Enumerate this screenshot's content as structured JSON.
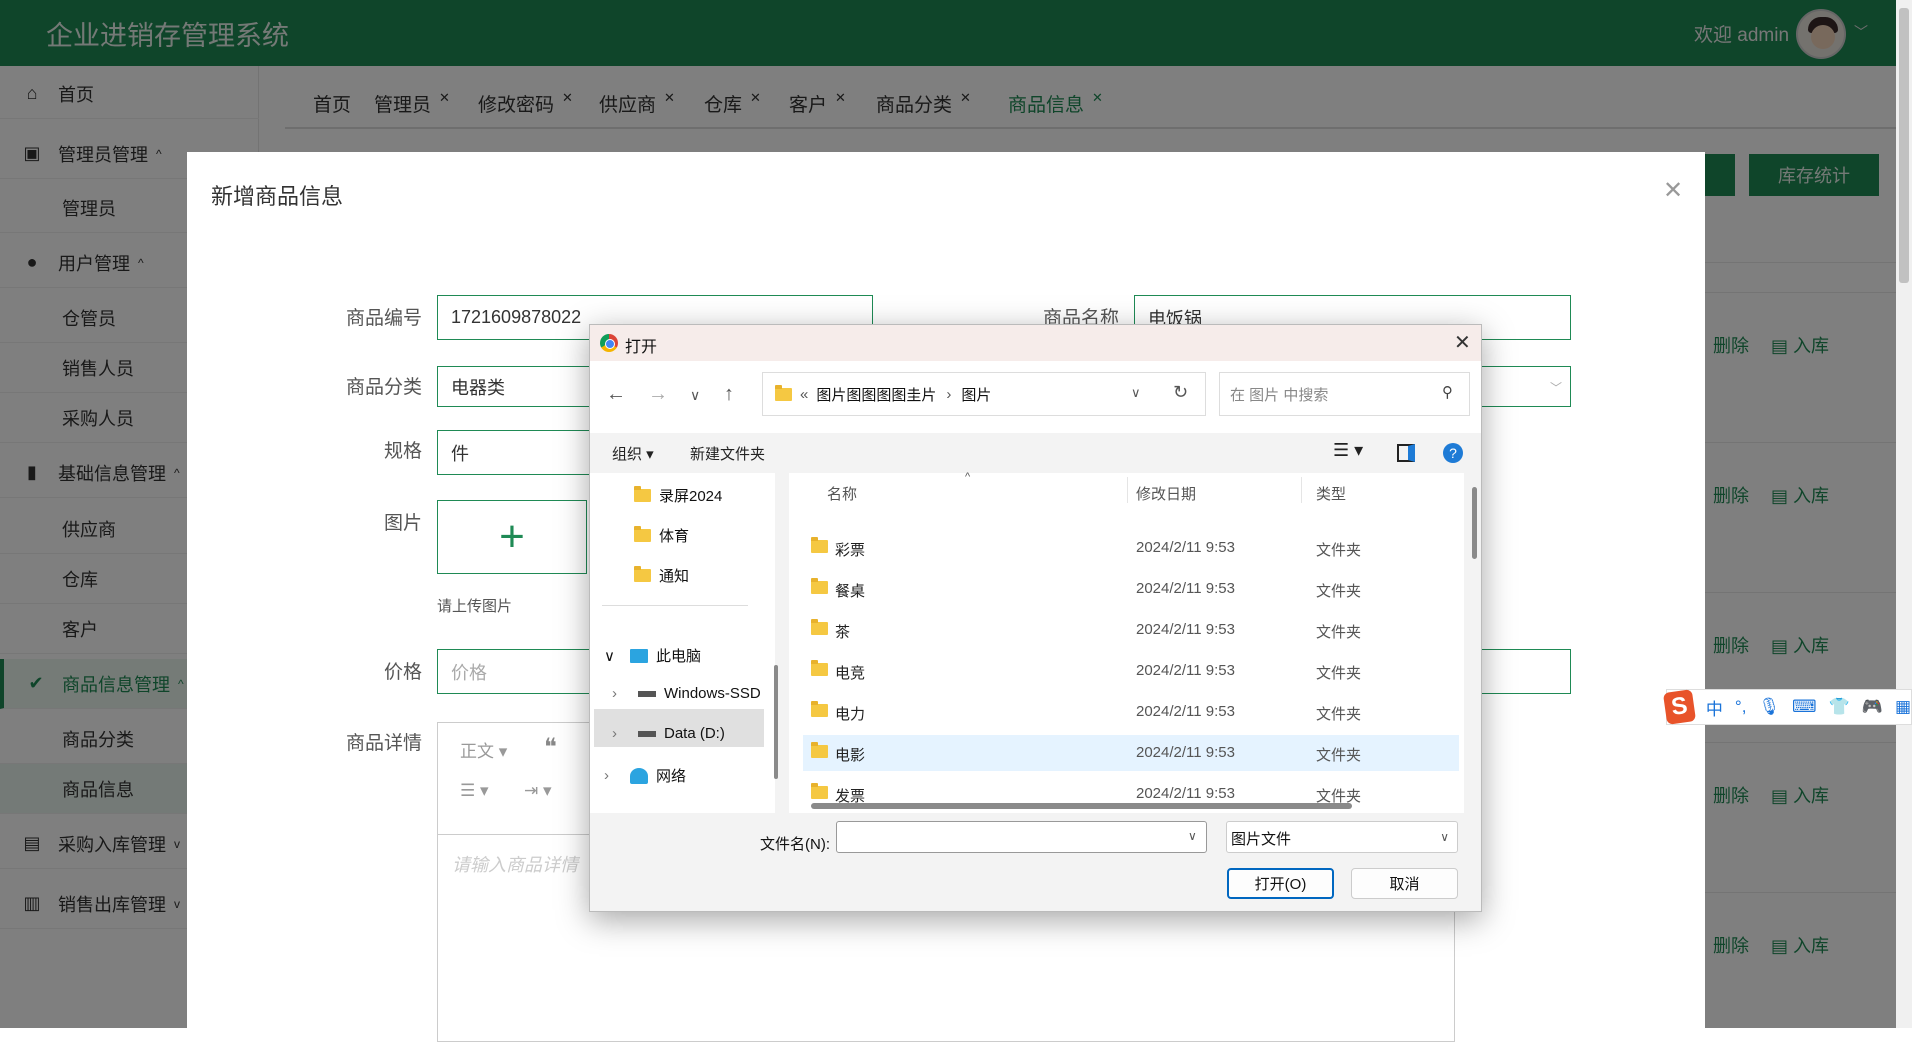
{
  "header": {
    "title": "企业进销存管理系统",
    "welcome": "欢迎 admin"
  },
  "sidebar": {
    "items": [
      {
        "label": "首页",
        "icon": "home-icon"
      },
      {
        "label": "管理员管理",
        "icon": "cpu-icon"
      },
      {
        "label": "管理员"
      },
      {
        "label": "用户管理",
        "icon": "user-icon"
      },
      {
        "label": "仓管员"
      },
      {
        "label": "销售人员"
      },
      {
        "label": "采购人员"
      },
      {
        "label": "基础信息管理",
        "icon": "book-icon"
      },
      {
        "label": "供应商"
      },
      {
        "label": "仓库"
      },
      {
        "label": "客户"
      },
      {
        "label": "商品信息管理",
        "icon": "check-circle-icon"
      },
      {
        "label": "商品分类"
      },
      {
        "label": "商品信息"
      },
      {
        "label": "采购入库管理",
        "icon": "archive-icon"
      },
      {
        "label": "销售出库管理",
        "icon": "bar-chart-icon"
      }
    ]
  },
  "tabs": [
    {
      "label": "首页"
    },
    {
      "label": "管理员"
    },
    {
      "label": "修改密码"
    },
    {
      "label": "供应商"
    },
    {
      "label": "仓库"
    },
    {
      "label": "客户"
    },
    {
      "label": "商品分类"
    },
    {
      "label": "商品信息"
    }
  ],
  "background": {
    "stock_stats_button": "库存统计",
    "row_actions": {
      "delete": "删除",
      "stock_in": "入库"
    }
  },
  "modal": {
    "title": "新增商品信息",
    "fields": {
      "code_label": "商品编号",
      "code_value": "1721609878022",
      "name_label": "商品名称",
      "name_value": "电饭锅",
      "category_label": "商品分类",
      "category_value": "电器类",
      "spec_label": "规格",
      "spec_value": "件",
      "image_label": "图片",
      "image_hint": "请上传图片",
      "price_label": "价格",
      "price_placeholder": "价格",
      "detail_label": "商品详情",
      "detail_placeholder": "请输入商品详情",
      "editor_heading": "正文"
    }
  },
  "file_dialog": {
    "title": "打开",
    "path": [
      "图片图图图图圭片",
      "图片"
    ],
    "search_placeholder": "在 图片 中搜索",
    "organize": "组织 ▾",
    "new_folder": "新建文件夹",
    "nav": [
      "录屏2024",
      "体育",
      "通知",
      "此电脑",
      "Windows-SSD",
      "Data (D:)",
      "网络"
    ],
    "columns": {
      "name": "名称",
      "date": "修改日期",
      "type": "类型"
    },
    "files": [
      {
        "name": "彩票",
        "date": "2024/2/11 9:53",
        "type": "文件夹"
      },
      {
        "name": "餐桌",
        "date": "2024/2/11 9:53",
        "type": "文件夹"
      },
      {
        "name": "茶",
        "date": "2024/2/11 9:53",
        "type": "文件夹"
      },
      {
        "name": "电竞",
        "date": "2024/2/11 9:53",
        "type": "文件夹"
      },
      {
        "name": "电力",
        "date": "2024/2/11 9:53",
        "type": "文件夹"
      },
      {
        "name": "电影",
        "date": "2024/2/11 9:53",
        "type": "文件夹"
      },
      {
        "name": "发票",
        "date": "2024/2/11 9:53",
        "type": "文件夹"
      }
    ],
    "filename_label": "文件名(N):",
    "filename_value": "",
    "filetype": "图片文件",
    "open_button": "打开(O)",
    "cancel_button": "取消"
  },
  "ime": {
    "mode": "中",
    "punct": "°,"
  }
}
